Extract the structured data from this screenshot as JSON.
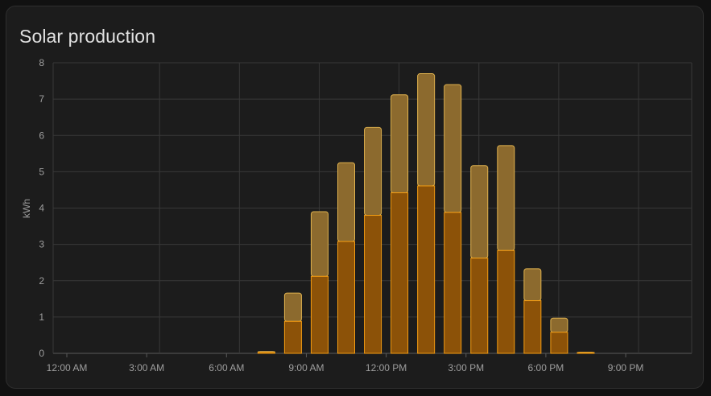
{
  "card": {
    "title": "Solar production"
  },
  "chart_data": {
    "type": "bar",
    "title": "Solar production",
    "ylabel": "kWh",
    "xlabel": "",
    "ylim": [
      0,
      8
    ],
    "yticks": [
      0,
      1,
      2,
      3,
      4,
      5,
      6,
      7,
      8
    ],
    "x_tick_labels": [
      "12:00 AM",
      "3:00 AM",
      "6:00 AM",
      "9:00 AM",
      "12:00 PM",
      "3:00 PM",
      "6:00 PM",
      "9:00 PM"
    ],
    "x_tick_hours": [
      0,
      3,
      6,
      9,
      12,
      15,
      18,
      21
    ],
    "hours": [
      7,
      8,
      9,
      10,
      11,
      12,
      13,
      14,
      15,
      16,
      17,
      18,
      19,
      20
    ],
    "grid": true,
    "stacked": true,
    "series": [
      {
        "values": [
          0.03,
          0.88,
          2.12,
          3.08,
          3.8,
          4.42,
          4.61,
          3.88,
          2.62,
          2.83,
          1.45,
          0.58,
          0.02,
          0
        ]
      },
      {
        "values": [
          0.02,
          0.78,
          1.78,
          2.17,
          2.42,
          2.7,
          3.09,
          3.52,
          2.55,
          2.89,
          0.88,
          0.39,
          0.01,
          0
        ]
      }
    ],
    "colors": {
      "bottom_fill": "#8c5208",
      "bottom_stroke": "#f39c12",
      "top_fill": "#8c6a2e",
      "top_stroke": "#e0b24e",
      "grid": "#383838",
      "axis": "#5a5a5a"
    }
  }
}
